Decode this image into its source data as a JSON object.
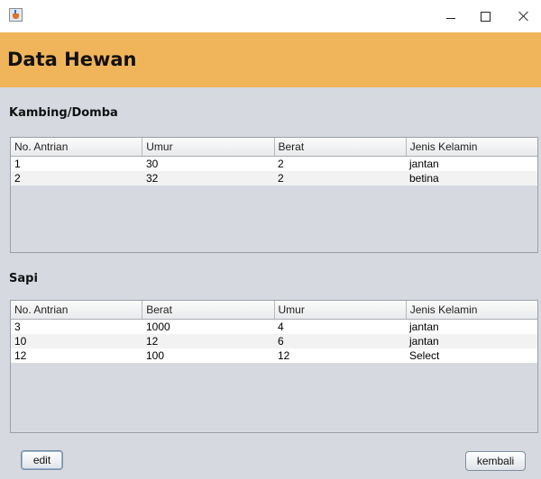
{
  "window": {
    "app_icon": "java-cup-icon",
    "controls": [
      "minimize-icon",
      "maximize-icon",
      "close-icon"
    ]
  },
  "header": {
    "title": "Data Hewan",
    "background": "#f0b45a"
  },
  "kambing": {
    "label": "Kambing/Domba",
    "columns": [
      "No. Antrian",
      "Umur",
      "Berat",
      "Jenis Kelamin"
    ],
    "rows": [
      [
        "1",
        "30",
        "2",
        "jantan"
      ],
      [
        "2",
        "32",
        "2",
        "betina"
      ]
    ]
  },
  "sapi": {
    "label": "Sapi",
    "columns": [
      "No. Antrian",
      "Berat",
      "Umur",
      "Jenis Kelamin"
    ],
    "rows": [
      [
        "3",
        "1000",
        "4",
        "jantan"
      ],
      [
        "10",
        "12",
        "6",
        "jantan"
      ],
      [
        "12",
        "100",
        "12",
        "Select"
      ]
    ]
  },
  "buttons": {
    "edit": "edit",
    "kembali": "kembali"
  }
}
